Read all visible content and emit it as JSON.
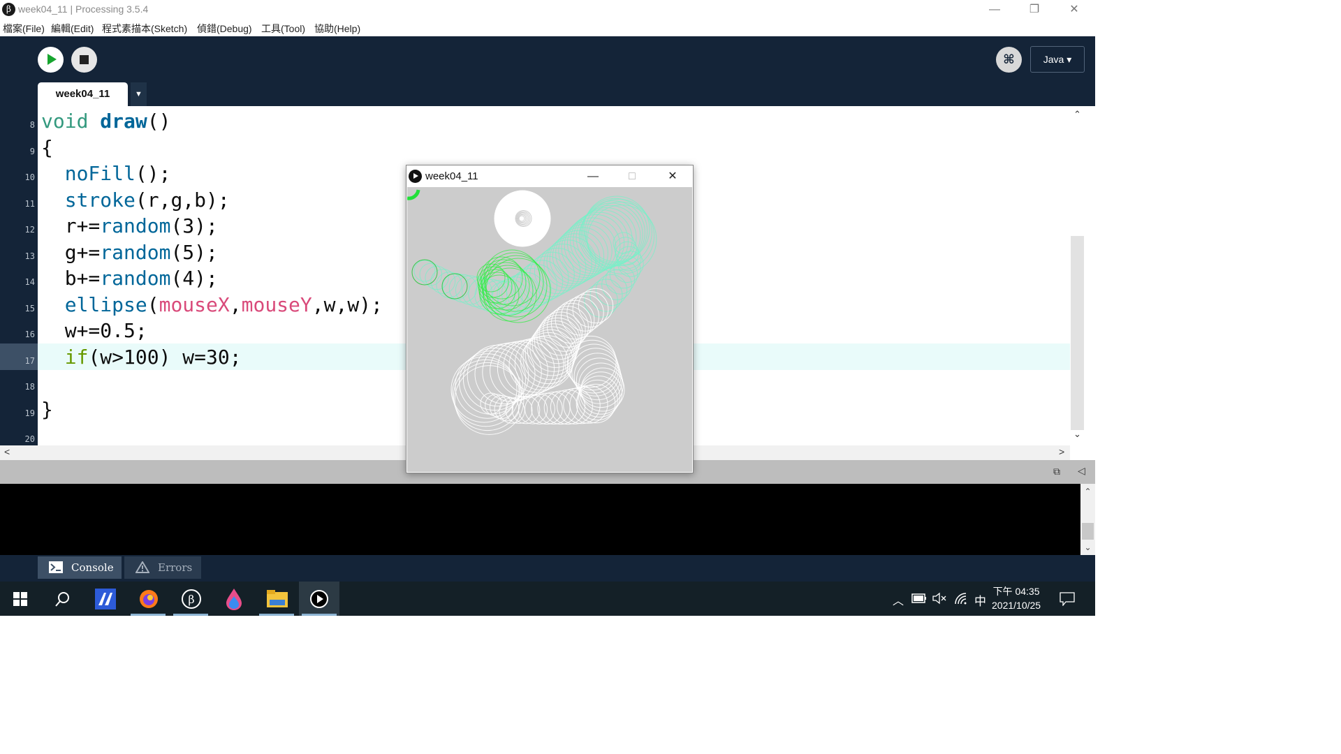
{
  "window": {
    "title": "week04_11 | Processing 3.5.4",
    "logo_glyph": "β",
    "minimize": "—",
    "maximize": "❐",
    "close": "✕"
  },
  "menu": {
    "file": "檔案(File)",
    "edit": "編輯(Edit)",
    "sketch": "程式素描本(Sketch)",
    "debug": "偵錯(Debug)",
    "tool": "工具(Tool)",
    "help": "協助(Help)"
  },
  "toolbar": {
    "mode_glyph": "⌘",
    "mode_label": "Java ▾"
  },
  "tabs": {
    "current": "week04_11",
    "menu_glyph": "▼"
  },
  "editor": {
    "line_numbers": [
      "8",
      "9",
      "10",
      "11",
      "12",
      "13",
      "14",
      "15",
      "16",
      "17",
      "18",
      "19",
      "20"
    ],
    "current_line": "17",
    "lines": {
      "l8_kw": "void",
      "l8_fn": "draw",
      "l8_rest": "()",
      "l9": "{",
      "l10_fn": "noFill",
      "l10_rest": "();",
      "l11_fn": "stroke",
      "l11_rest": "(r,g,b);",
      "l12_pre": "r+=",
      "l12_fn": "random",
      "l12_rest": "(3);",
      "l13_pre": "g+=",
      "l13_fn": "random",
      "l13_rest": "(5);",
      "l14_pre": "b+=",
      "l14_fn": "random",
      "l14_rest": "(4);",
      "l15_fn": "ellipse",
      "l15_p1": "(",
      "l15_v1": "mouseX",
      "l15_p2": ",",
      "l15_v2": "mouseY",
      "l15_rest": ",w,w);",
      "l16": "w+=0.5;",
      "l17_kw": "if",
      "l17_rest": "(w>100) w=30;",
      "l19": "}"
    }
  },
  "scrollbar": {
    "up": "⌃",
    "down": "⌄",
    "left": "<",
    "right": ">"
  },
  "status": {
    "copy_icon": "⧉",
    "collapse_icon": "◁"
  },
  "console_tabs": {
    "console": "Console",
    "errors": "Errors"
  },
  "sketch_window": {
    "title": "week04_11",
    "minimize": "—",
    "maximize": "□",
    "close": "✕"
  },
  "taskbar": {
    "ime": "中",
    "time": "下午 04:35",
    "date": "2021/10/25",
    "chevron": "︿"
  },
  "colors": {
    "toolbar_bg": "#142438",
    "run_green": "#17a52f",
    "keyword_green": "#33997e",
    "function_blue": "#006699",
    "variable_pink": "#d94a7a",
    "control_green": "#669900",
    "current_line_highlight": "#e9fbfa",
    "canvas_bg": "#cccccc"
  }
}
